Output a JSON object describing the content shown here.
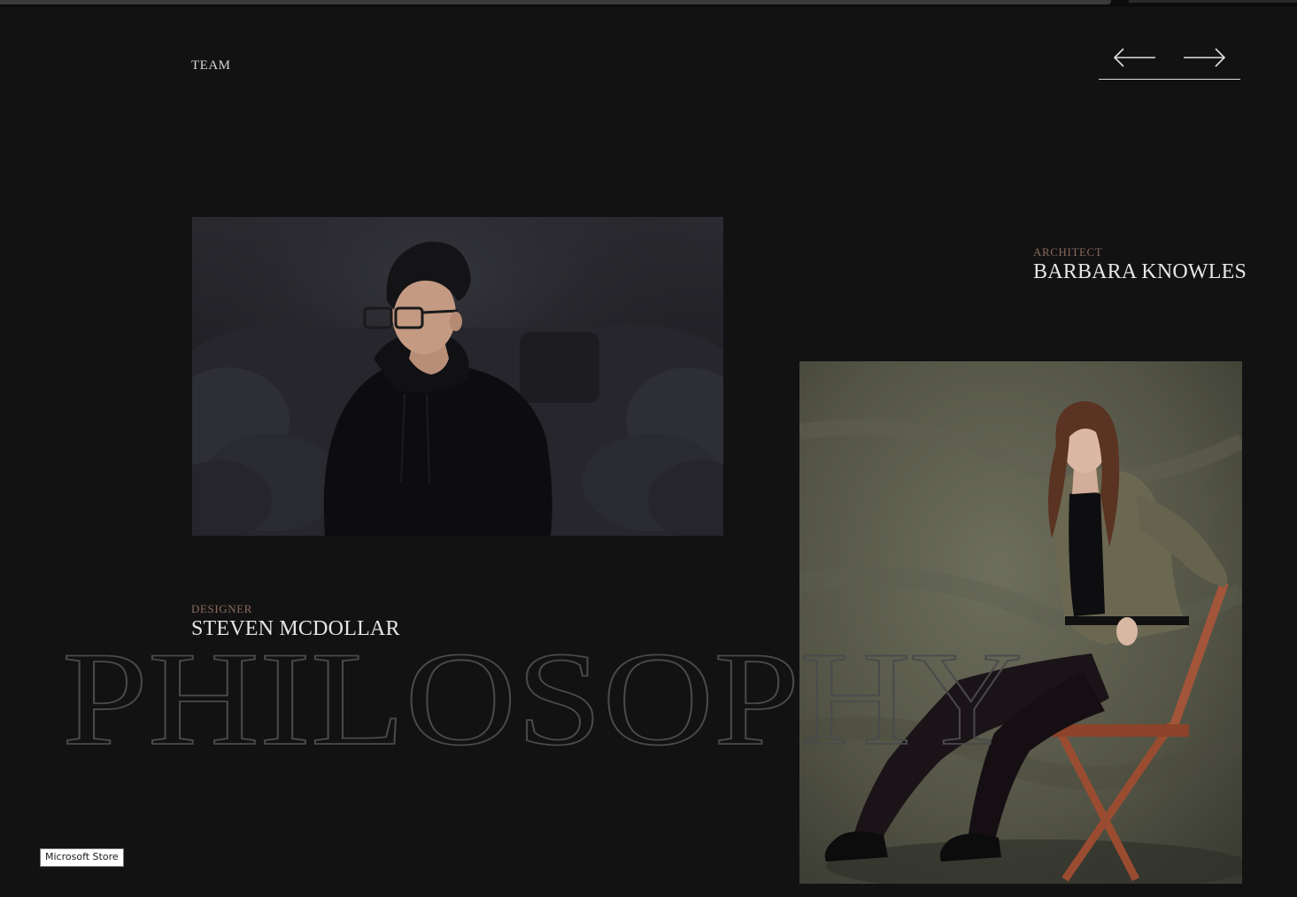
{
  "section": {
    "label": "TEAM"
  },
  "nav": {
    "prev_icon": "arrow-left-icon",
    "next_icon": "arrow-right-icon"
  },
  "members": [
    {
      "role": "DESIGNER",
      "name": "STEVEN MCDOLLAR"
    },
    {
      "role": "ARCHITECT",
      "name": "BARBARA KNOWLES"
    }
  ],
  "background_word": "PHILOSOPHY",
  "tooltip": {
    "text": "Microsoft Store"
  },
  "colors": {
    "background": "#121213",
    "role_accent": "#8a6a5c",
    "name_text": "#e6e6e6",
    "outline_text": "#4a4a4c"
  }
}
